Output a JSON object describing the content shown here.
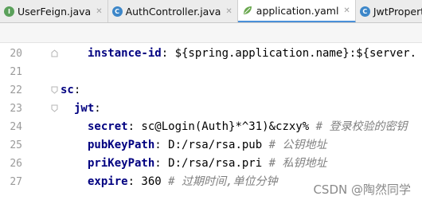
{
  "tabs": [
    {
      "label": "UserFeign.java",
      "icon": "I",
      "icon_color": "#5aa05a",
      "active": false
    },
    {
      "label": "AuthController.java",
      "icon": "C",
      "icon_color": "#3d87c9",
      "active": false
    },
    {
      "label": "application.yaml",
      "icon": "leaf",
      "icon_color": "#6aa84f",
      "active": true
    },
    {
      "label": "JwtProperties.java",
      "icon": "C",
      "icon_color": "#3d87c9",
      "active": false
    }
  ],
  "editor": {
    "lines": [
      {
        "num": "20",
        "indent": "    ",
        "key": "instance-id",
        "rest": ": ${spring.application.name}:${server.",
        "comment": ""
      },
      {
        "num": "21",
        "indent": "",
        "key": "",
        "rest": "",
        "comment": ""
      },
      {
        "num": "22",
        "indent": "",
        "key": "sc",
        "rest": ":",
        "comment": ""
      },
      {
        "num": "23",
        "indent": "  ",
        "key": "jwt",
        "rest": ":",
        "comment": ""
      },
      {
        "num": "24",
        "indent": "    ",
        "key": "secret",
        "rest": ": sc@Login(Auth}*^31)&czxy% ",
        "comment": "# 登录校验的密钥"
      },
      {
        "num": "25",
        "indent": "    ",
        "key": "pubKeyPath",
        "rest": ": D:/rsa/rsa.pub ",
        "comment": "# 公钥地址"
      },
      {
        "num": "26",
        "indent": "    ",
        "key": "priKeyPath",
        "rest": ": D:/rsa/rsa.pri ",
        "comment": "# 私钥地址"
      },
      {
        "num": "27",
        "indent": "    ",
        "key": "expire",
        "rest": ": 360 ",
        "comment": "# 过期时间,单位分钟"
      }
    ]
  },
  "watermark": "CSDN @陶然同学"
}
